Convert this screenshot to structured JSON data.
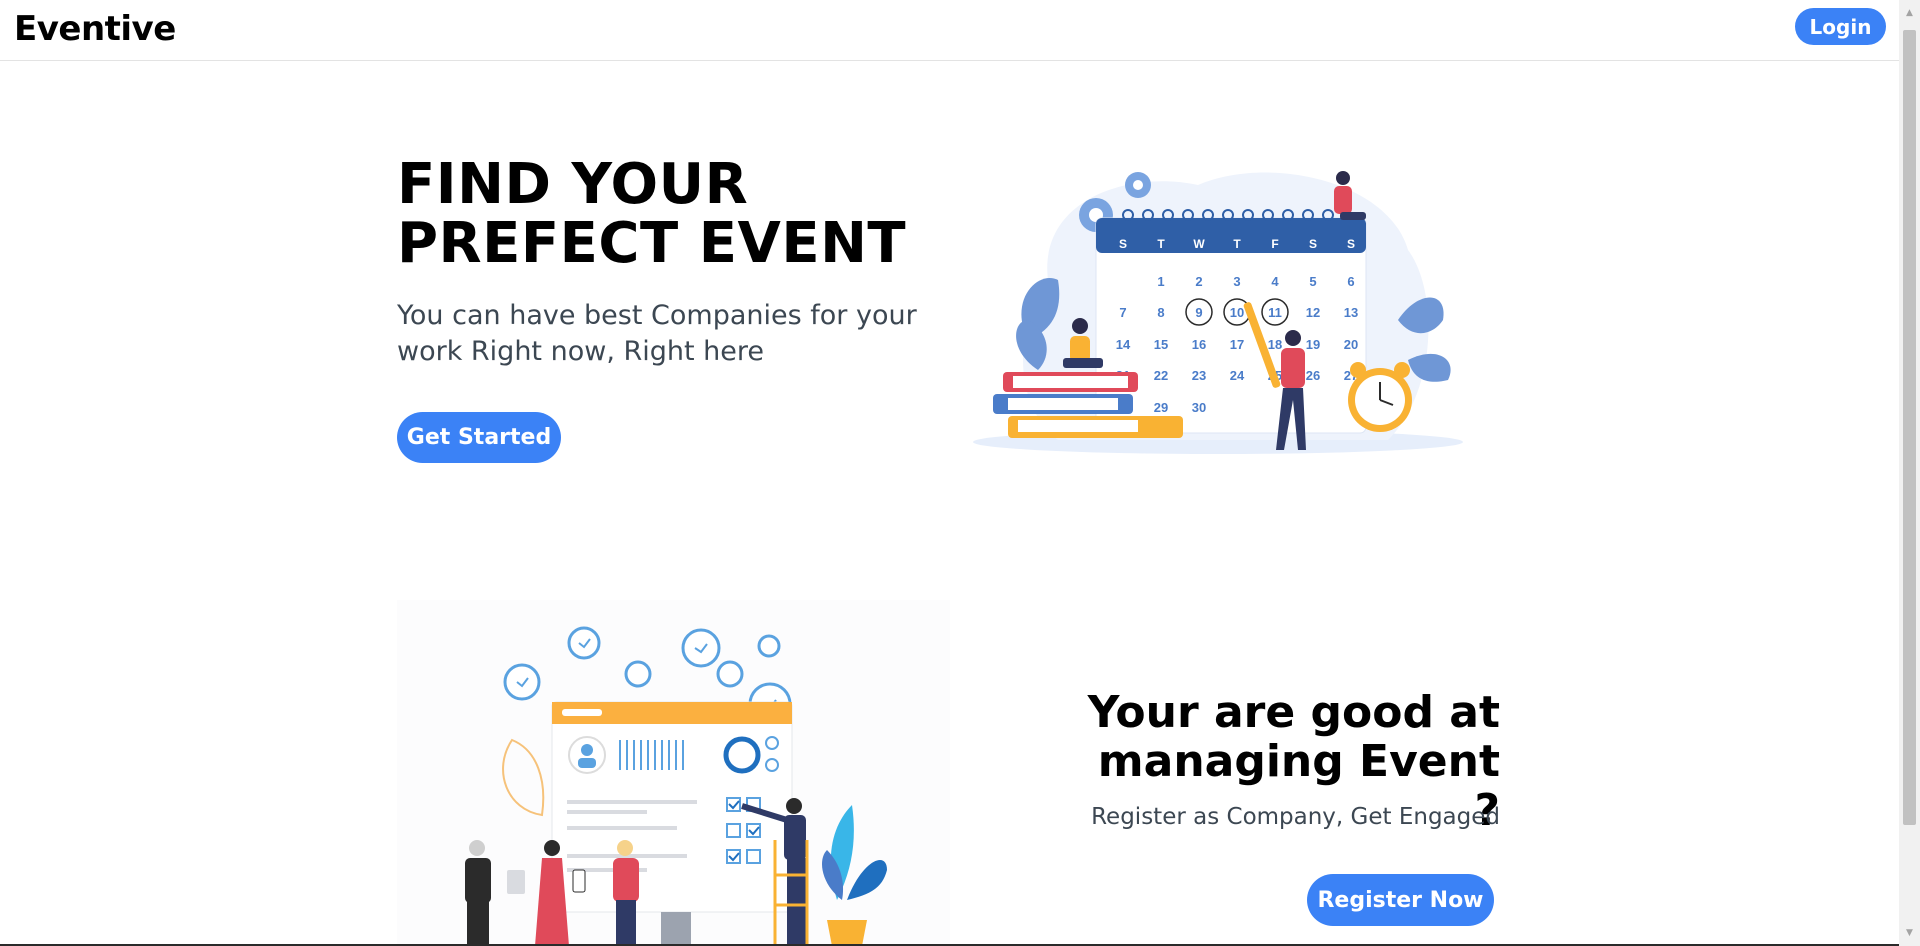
{
  "navbar": {
    "brand": "Eventive",
    "login_label": "Login"
  },
  "hero": {
    "title": "FIND YOUR PREFECT EVENT",
    "subtitle": "You can have best Companies for your work Right now, Right here",
    "cta_label": "Get Started"
  },
  "calendar": {
    "weekdays": [
      "S",
      "T",
      "W",
      "T",
      "F",
      "S",
      "S"
    ],
    "row1": [
      "1",
      "2",
      "3",
      "4",
      "5",
      "6"
    ],
    "row2": [
      "7",
      "8",
      "9",
      "10",
      "11",
      "12",
      "13"
    ],
    "row3": [
      "14",
      "15",
      "16",
      "17",
      "18",
      "19",
      "20"
    ],
    "row4": [
      "21",
      "22",
      "23",
      "24",
      "25",
      "26",
      "27"
    ],
    "row5": [
      "29",
      "30"
    ]
  },
  "company": {
    "title": "Your are good at managing Event ?",
    "subtitle": "Register as Company, Get Engaged",
    "cta_label": "Register Now"
  },
  "colors": {
    "accent": "#3b82f6",
    "text_muted": "#3c4752",
    "calendar_blue": "#2f5fa7",
    "illus_orange": "#f9b233"
  },
  "icons": [
    "gear-icon",
    "clock-icon",
    "alarm-clock-icon",
    "book-icon",
    "leaf-icon",
    "checkbox-icon"
  ]
}
